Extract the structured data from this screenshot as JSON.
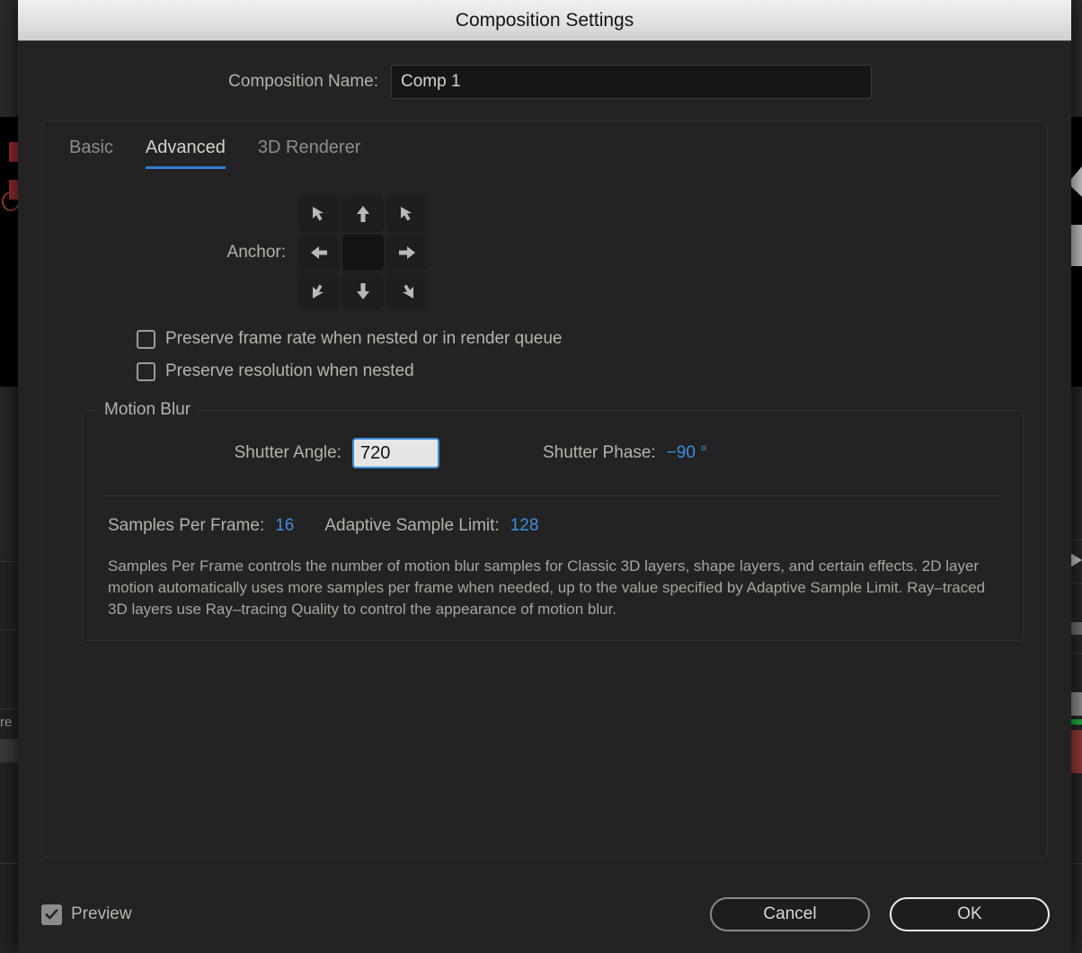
{
  "window": {
    "title": "Composition Settings"
  },
  "comp_name": {
    "label": "Composition Name:",
    "value": "Comp 1",
    "placeholder": "Composition Name"
  },
  "tabs": [
    {
      "label": "Basic",
      "active": false
    },
    {
      "label": "Advanced",
      "active": true
    },
    {
      "label": "3D Renderer",
      "active": false
    }
  ],
  "anchor": {
    "label": "Anchor:",
    "cells": [
      "anchor-top-left",
      "anchor-top-center",
      "anchor-top-right",
      "anchor-middle-left",
      "anchor-center",
      "anchor-middle-right",
      "anchor-bottom-left",
      "anchor-bottom-center",
      "anchor-bottom-right"
    ],
    "selected": "anchor-center"
  },
  "checkboxes": [
    {
      "label": "Preserve frame rate when nested or in render queue",
      "checked": false
    },
    {
      "label": "Preserve resolution when nested",
      "checked": false
    }
  ],
  "motion_blur": {
    "legend": "Motion Blur",
    "shutter_angle": {
      "label": "Shutter Angle:",
      "value": "720",
      "focused": true
    },
    "shutter_phase": {
      "label": "Shutter Phase:",
      "value": "−90 °"
    },
    "samples_per_frame": {
      "label": "Samples Per Frame:",
      "value": "16"
    },
    "adaptive_sample_limit": {
      "label": "Adaptive Sample Limit:",
      "value": "128"
    },
    "description": "Samples Per Frame controls the number of motion blur samples for Classic 3D layers, shape layers, and certain effects. 2D layer motion automatically uses more samples per frame when needed, up to the value specified by Adaptive Sample Limit. Ray–traced 3D layers use Ray–tracing Quality to control the appearance of motion blur."
  },
  "footer": {
    "preview": {
      "label": "Preview",
      "checked": true
    },
    "cancel_label": "Cancel",
    "ok_label": "OK"
  },
  "colors": {
    "accent_blue": "#3c8ede",
    "dialog_bg": "#232323",
    "title_bar_light": "#efefef",
    "label_text": "#b7b1a9",
    "default_button_border": "#ededed"
  },
  "background_app": {
    "left_text": "re"
  }
}
